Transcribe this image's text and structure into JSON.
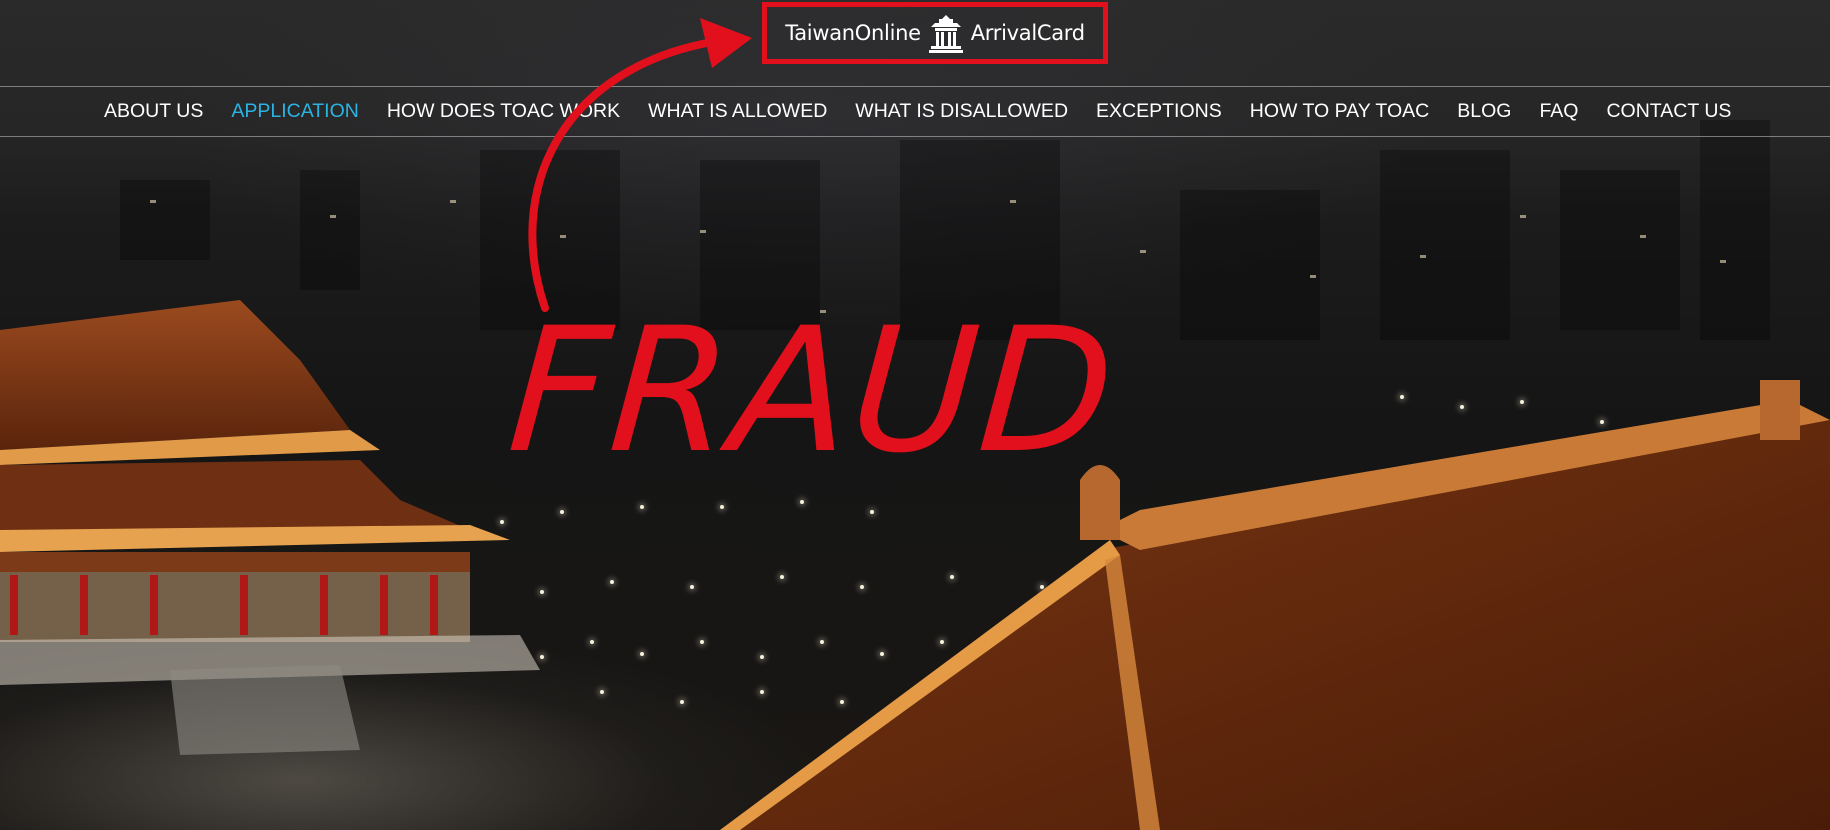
{
  "logo": {
    "text_left": "TaiwanOnline",
    "text_right": "ArrivalCard",
    "icon": "pagoda-building-icon"
  },
  "nav": {
    "items": [
      {
        "label": "ABOUT US",
        "active": false
      },
      {
        "label": "APPLICATION",
        "active": true
      },
      {
        "label": "HOW DOES TOAC WORK",
        "active": false
      },
      {
        "label": "WHAT IS ALLOWED",
        "active": false
      },
      {
        "label": "WHAT IS DISALLOWED",
        "active": false
      },
      {
        "label": "EXCEPTIONS",
        "active": false
      },
      {
        "label": "HOW TO PAY TOAC",
        "active": false
      },
      {
        "label": "BLOG",
        "active": false
      },
      {
        "label": "FAQ",
        "active": false
      },
      {
        "label": "CONTACT US",
        "active": false
      }
    ],
    "active_color": "#2bb4e3",
    "text_color": "#ffffff"
  },
  "overlay": {
    "label": "FRAUD",
    "color": "#e2101c",
    "arrow_icon": "curved-arrow-icon"
  },
  "background": {
    "description_icon": "night-city-temple-background"
  }
}
